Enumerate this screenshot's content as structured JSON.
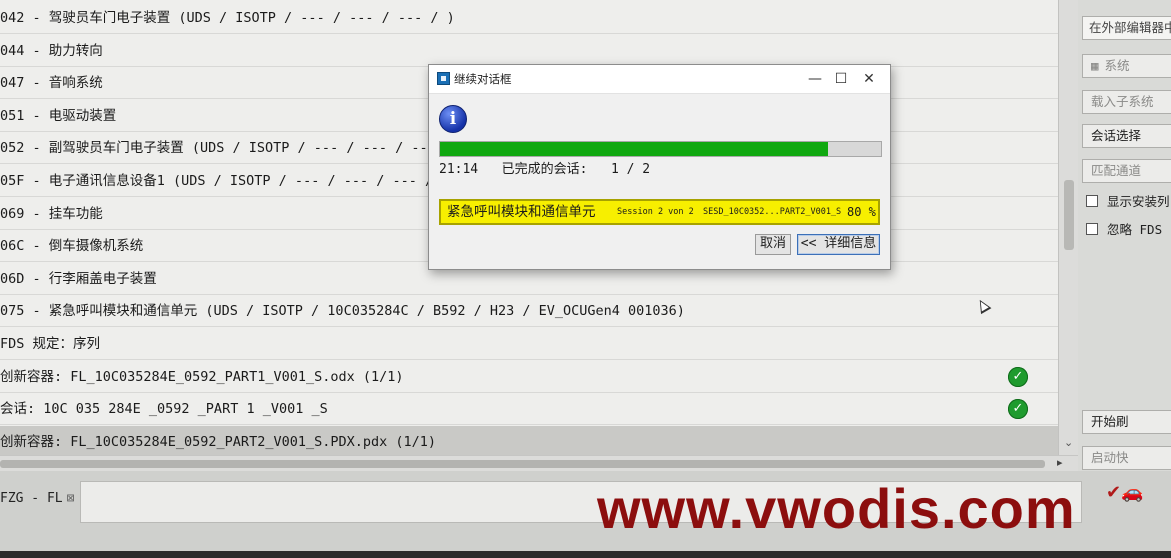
{
  "list": {
    "rows": [
      {
        "text": "042 - 驾驶员车门电子装置  (UDS / ISOTP / --- / --- / --- /  )"
      },
      {
        "text": "044 - 助力转向"
      },
      {
        "text": "047 - 音响系统"
      },
      {
        "text": "051 - 电驱动装置"
      },
      {
        "text": "052 - 副驾驶员车门电子装置  (UDS / ISOTP / --- / --- / --- /  )"
      },
      {
        "text": "05F - 电子通讯信息设备1  (UDS / ISOTP / --- / --- / --- /  )"
      },
      {
        "text": "069 - 挂车功能"
      },
      {
        "text": "06C - 倒车摄像机系统"
      },
      {
        "text": "06D - 行李厢盖电子装置"
      },
      {
        "text": "075 - 紧急呼叫模块和通信单元  (UDS / ISOTP / 10C035284C / B592 / H23 / EV_OCUGen4 001036)"
      },
      {
        "text": "FDS 规定：序列"
      },
      {
        "text": "创新容器: FL_10C035284E_0592_PART1_V001_S.odx (1/1)",
        "done": true
      },
      {
        "text": "  会话: 10C 035 284E _0592 _PART 1 _V001 _S",
        "done": true
      },
      {
        "text": "创新容器: FL_10C035284E_0592_PART2_V001_S.PDX.pdx (1/1)",
        "selected": true
      },
      {
        "text": ""
      }
    ]
  },
  "sidebar": {
    "input_placeholder": "在外部编辑器中",
    "buttons": [
      {
        "label": "系统",
        "disabled": true
      },
      {
        "label": "载入子系统",
        "disabled": true
      },
      {
        "label": "会话选择",
        "disabled": false
      },
      {
        "label": "匹配通道",
        "disabled": true
      }
    ],
    "checkboxes": [
      {
        "label": "显示安装列"
      },
      {
        "label": "忽略 FDS"
      }
    ],
    "bottom_buttons": [
      {
        "label": "开始刷"
      },
      {
        "label": "启动快"
      }
    ]
  },
  "bottom_tab": {
    "label": "FZG - FL",
    "close": "⊠"
  },
  "dialog": {
    "title": "继续对话框",
    "minimize": "—",
    "maximize": "☐",
    "close": "✕",
    "progress_fraction": 0.88,
    "time": "21:14",
    "completed_label": "已完成的会话:",
    "completed_value": "1 / 2",
    "session_name": "紧急呼叫模块和通信单元",
    "session_info": "Session 2 von 2",
    "session_file": "SESD_10C0352...PART2_V001_S",
    "session_percent": "80 %",
    "cancel_label": "取消",
    "details_label": "<< 详细信息"
  },
  "watermark": "www.vwodis.com",
  "colors": {
    "progress": "#10a810",
    "session_highlight": "#f7ef00",
    "ok_icon": "#1f9b2e",
    "watermark": "#8c0e0e"
  }
}
